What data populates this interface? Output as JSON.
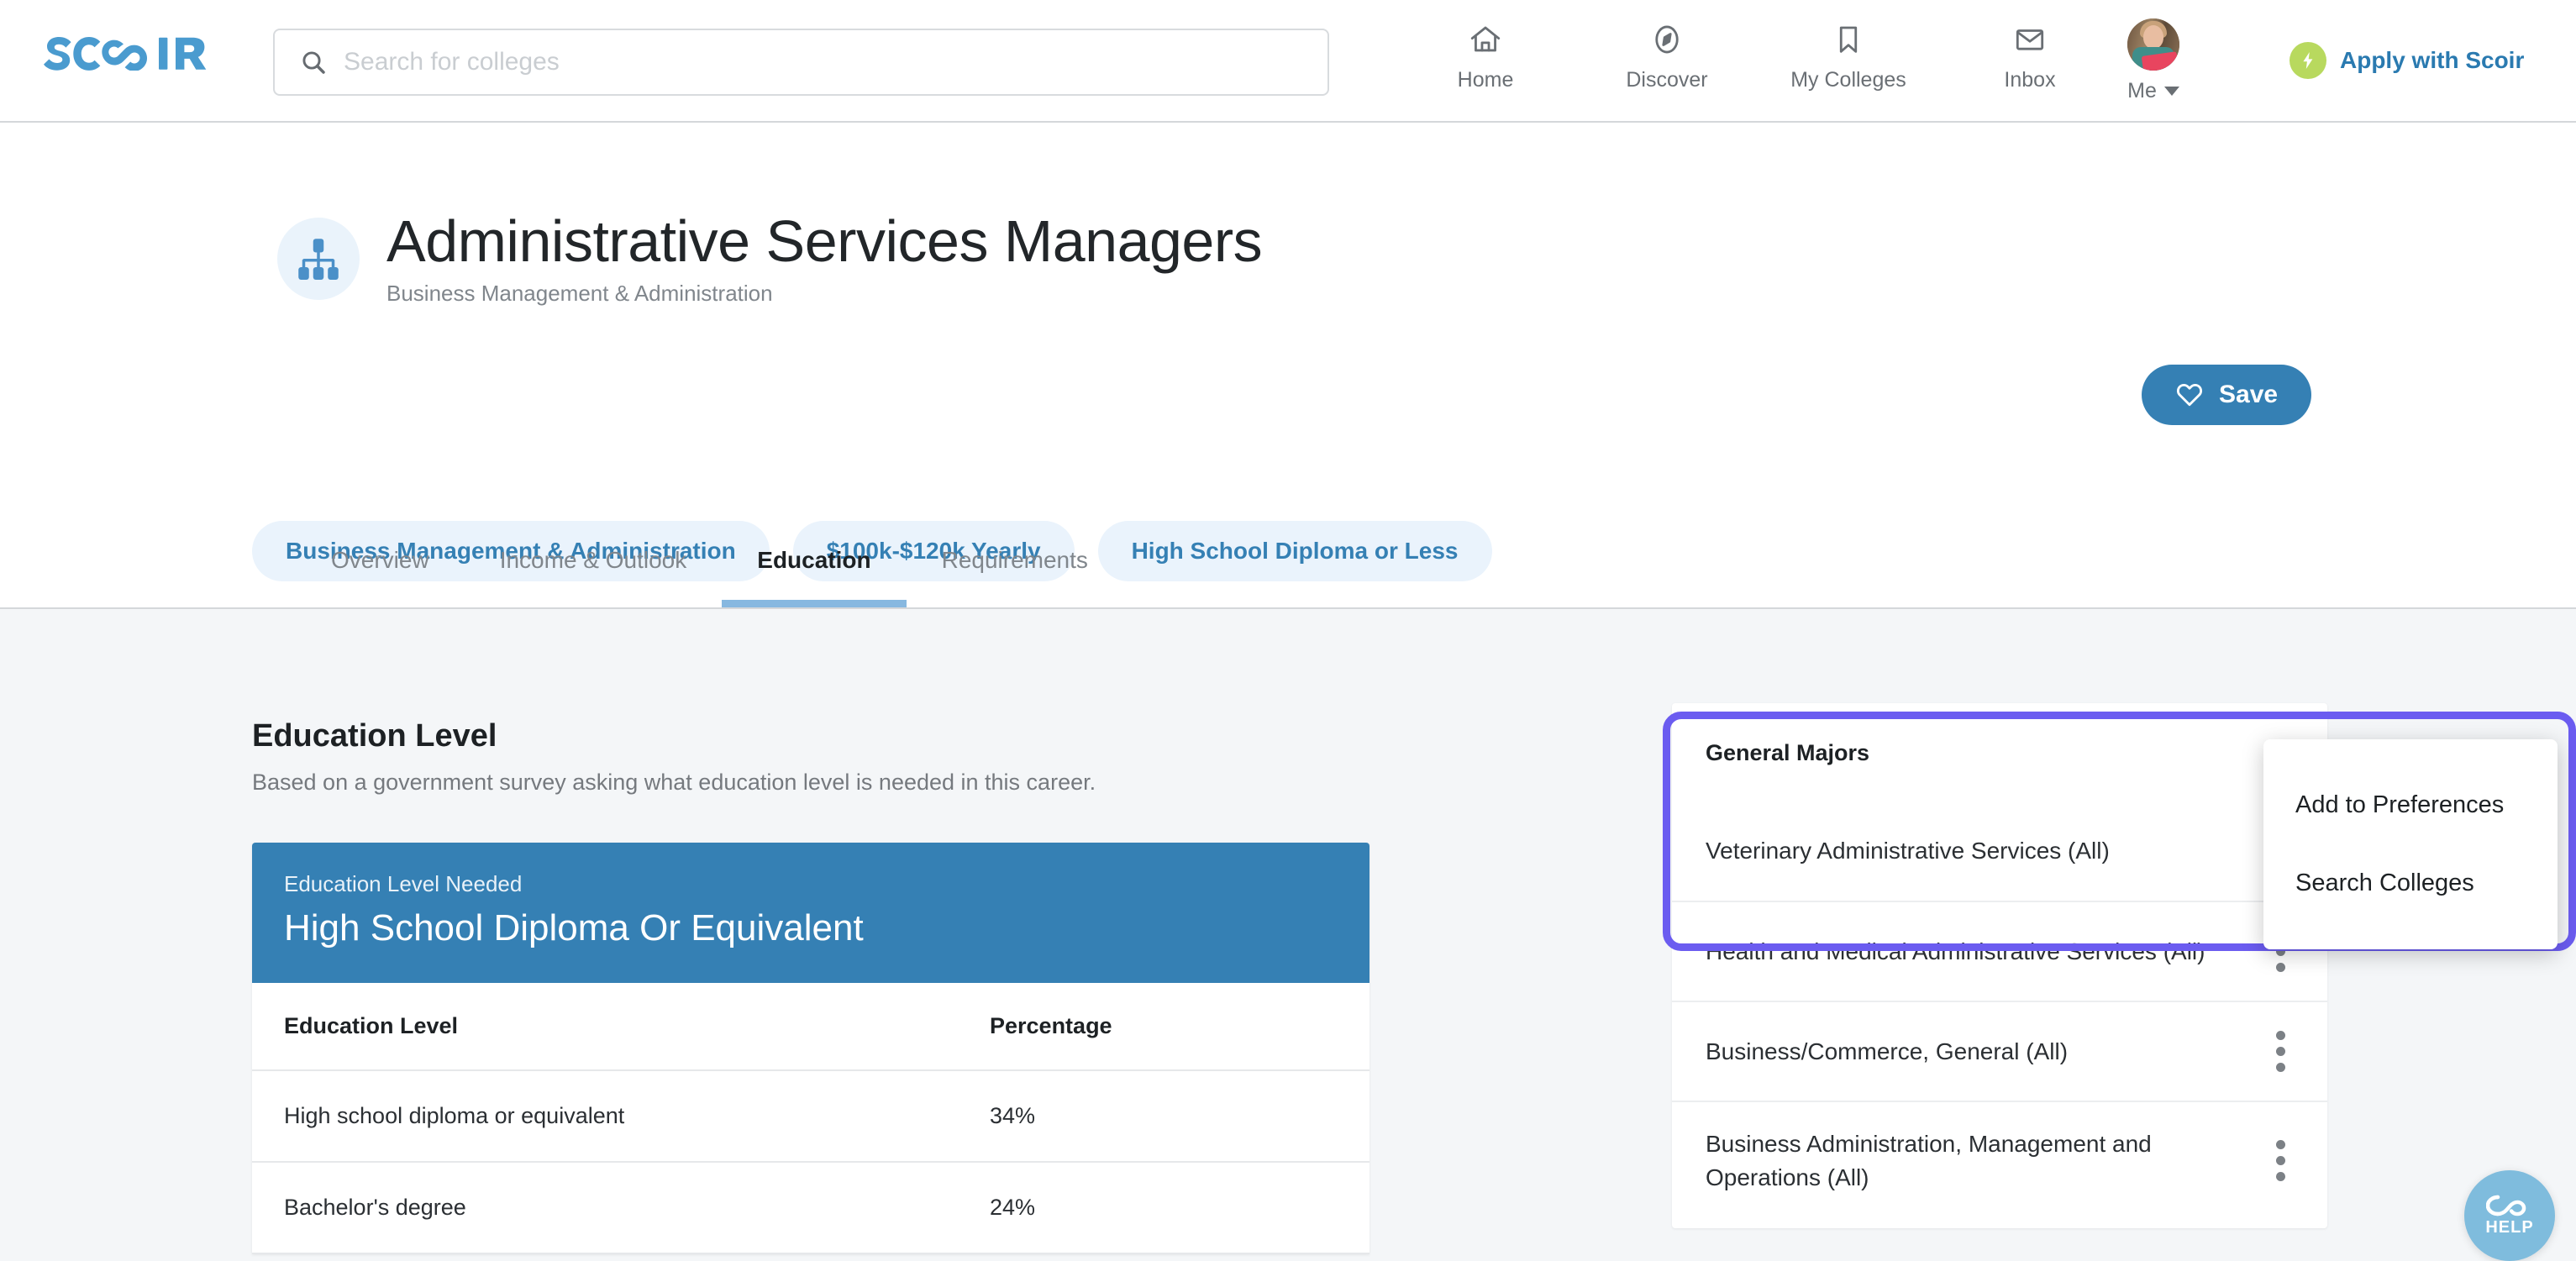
{
  "brand": {
    "name": "SCOIR",
    "logo_icon": "scoir-infinity-logo"
  },
  "header": {
    "search": {
      "placeholder": "Search for colleges",
      "value": "",
      "icon": "search-icon"
    },
    "nav": [
      {
        "label": "Home",
        "icon": "home-icon"
      },
      {
        "label": "Discover",
        "icon": "compass-icon"
      },
      {
        "label": "My Colleges",
        "icon": "bookmark-icon"
      },
      {
        "label": "Inbox",
        "icon": "envelope-icon"
      }
    ],
    "account": {
      "label": "Me",
      "icon": "avatar",
      "caret": "chevron-down-icon"
    },
    "apply": {
      "label": "Apply with Scoir",
      "icon": "lightning-bolt-icon",
      "icon_color": "#b8d95e",
      "text_color": "#2a7ab0"
    }
  },
  "hero": {
    "icon": "org-chart-icon",
    "title": "Administrative Services Managers",
    "subtitle": "Business Management & Administration",
    "save_button": {
      "label": "Save",
      "icon": "heart-icon",
      "color": "#3580b4"
    },
    "pills": [
      "Business Management & Administration",
      "$100k-$120k Yearly",
      "High School Diploma or Less"
    ],
    "tabs": [
      {
        "label": "Overview",
        "active": false
      },
      {
        "label": "Income & Outlook",
        "active": false
      },
      {
        "label": "Education",
        "active": true
      },
      {
        "label": "Requirements",
        "active": false
      }
    ]
  },
  "education": {
    "section_title": "Education Level",
    "section_subtitle": "Based on a government survey asking what education level is needed in this career.",
    "banner": {
      "label": "Education Level Needed",
      "value": "High School Diploma Or Equivalent",
      "color": "#3580b4"
    },
    "table": {
      "columns": [
        "Education Level",
        "Percentage"
      ],
      "rows": [
        {
          "level": "High school diploma or equivalent",
          "percentage": "34%"
        },
        {
          "level": "Bachelor's degree",
          "percentage": "24%"
        }
      ]
    }
  },
  "majors": {
    "heading": "General Majors",
    "items": [
      {
        "name": "Veterinary Administrative Services (All)",
        "menu_icon": "kebab-menu-icon"
      },
      {
        "name": "Health and Medical Administrative Services (All)",
        "menu_icon": "kebab-menu-icon"
      },
      {
        "name": "Business/Commerce, General (All)",
        "menu_icon": "kebab-menu-icon"
      },
      {
        "name": "Business Administration, Management and Operations (All)",
        "menu_icon": "kebab-menu-icon"
      }
    ]
  },
  "context_menu": {
    "items": [
      "Add to Preferences",
      "Search Colleges"
    ]
  },
  "focus_highlight": {
    "color": "#6b5cf0"
  },
  "help_widget": {
    "label": "HELP",
    "icon": "scoir-infinity-logo",
    "color": "#7fbcdd"
  }
}
